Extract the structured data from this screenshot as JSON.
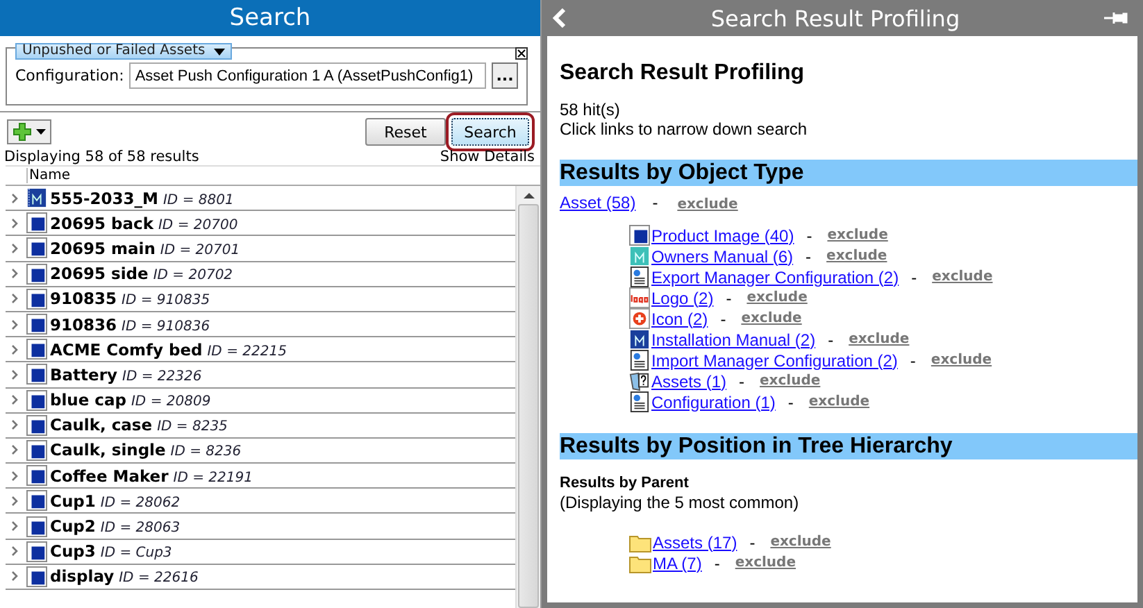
{
  "search_panel": {
    "title": "Search",
    "filter": {
      "dropdown": "Unpushed or Failed Assets",
      "config_label": "Configuration:",
      "config_value": "Asset Push Configuration 1 A (AssetPushConfig1)",
      "browse_label": "..."
    },
    "buttons": [
      {
        "label": "Reset",
        "selected": false
      },
      {
        "label": "Search",
        "selected": true
      }
    ],
    "result_count": "Displaying 58 of 58 results",
    "show_details": "Show Details",
    "table": {
      "columns": [
        "Name"
      ],
      "rows": [
        {
          "name": "555-2033_M",
          "id": "ID = 8801",
          "kind": "manual"
        },
        {
          "name": "20695 back",
          "id": "ID = 20700",
          "kind": "cube"
        },
        {
          "name": "20695 main",
          "id": "ID = 20701",
          "kind": "cube"
        },
        {
          "name": "20695 side",
          "id": "ID = 20702",
          "kind": "cube"
        },
        {
          "name": "910835",
          "id": "ID = 910835",
          "kind": "cube"
        },
        {
          "name": "910836",
          "id": "ID = 910836",
          "kind": "cube"
        },
        {
          "name": "ACME Comfy bed",
          "id": "ID = 22215",
          "kind": "cube"
        },
        {
          "name": "Battery",
          "id": "ID = 22326",
          "kind": "cube"
        },
        {
          "name": "blue cap",
          "id": "ID = 20809",
          "kind": "cube"
        },
        {
          "name": "Caulk, case",
          "id": "ID = 8235",
          "kind": "cube"
        },
        {
          "name": "Caulk, single",
          "id": "ID = 8236",
          "kind": "cube"
        },
        {
          "name": "Coffee Maker",
          "id": "ID = 22191",
          "kind": "cube"
        },
        {
          "name": "Cup1",
          "id": "ID = 28062",
          "kind": "cube"
        },
        {
          "name": "Cup2",
          "id": "ID = 28063",
          "kind": "cube"
        },
        {
          "name": "Cup3",
          "id": "ID = Cup3",
          "kind": "cube"
        },
        {
          "name": "display",
          "id": "ID = 22616",
          "kind": "cube"
        }
      ]
    }
  },
  "profiling_panel": {
    "title": "Search Result Profiling",
    "heading": "Search Result Profiling",
    "hits": "58 hit(s)",
    "hint": "Click links to narrow down search",
    "object_type": {
      "heading": "Results by Object Type",
      "top": {
        "link": "Asset (58)",
        "separator": "-",
        "exclude": "exclude"
      },
      "items": [
        {
          "link": "Product Image (40)",
          "separator": "-",
          "exclude": "exclude",
          "kind": "cube"
        },
        {
          "link": "Owners Manual (6)",
          "separator": "-",
          "exclude": "exclude",
          "kind": "manual-teal"
        },
        {
          "link": "Export Manager Configuration (2)",
          "separator": "-",
          "exclude": "exclude",
          "kind": "config"
        },
        {
          "link": "Logo (2)",
          "separator": "-",
          "exclude": "exclude",
          "kind": "logo"
        },
        {
          "link": "Icon (2)",
          "separator": "-",
          "exclude": "exclude",
          "kind": "icon"
        },
        {
          "link": "Installation Manual (2)",
          "separator": "-",
          "exclude": "exclude",
          "kind": "manual"
        },
        {
          "link": "Import Manager Configuration (2)",
          "separator": "-",
          "exclude": "exclude",
          "kind": "config"
        },
        {
          "link": "Assets (1)",
          "separator": "-",
          "exclude": "exclude",
          "kind": "unknown"
        },
        {
          "link": "Configuration (1)",
          "separator": "-",
          "exclude": "exclude",
          "kind": "config"
        }
      ]
    },
    "tree": {
      "heading": "Results by Position in Tree Hierarchy",
      "subheading": "Results by Parent",
      "note": "(Displaying the 5 most common)",
      "items": [
        {
          "link": "Assets (17)",
          "separator": "-",
          "exclude": "exclude",
          "kind": "folder"
        },
        {
          "link": "MA (7)",
          "separator": "-",
          "exclude": "exclude",
          "kind": "folder"
        }
      ]
    }
  }
}
